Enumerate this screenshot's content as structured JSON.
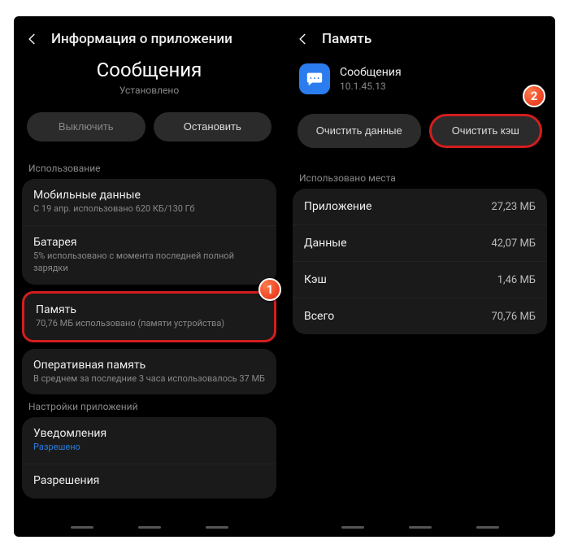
{
  "left": {
    "header_title": "Информация о приложении",
    "app_name": "Сообщения",
    "app_status": "Установлено",
    "btn_disable": "Выключить",
    "btn_stop": "Остановить",
    "section_usage": "Использование",
    "items": {
      "mobile_data": {
        "title": "Мобильные данные",
        "sub": "С 19 апр. использовано 620 КБ/130 Гб"
      },
      "battery": {
        "title": "Батарея",
        "sub": "5% использовано с момента последней полной зарядки"
      },
      "storage": {
        "title": "Память",
        "sub": "70,76 МБ использовано (памяти устройства)"
      },
      "ram": {
        "title": "Оперативная память",
        "sub": "В среднем за последние 3 часа использовалось 37 МБ"
      }
    },
    "section_app_settings": "Настройки приложений",
    "notifications": {
      "title": "Уведомления",
      "sub": "Разрешено"
    },
    "permissions_title": "Разрешения",
    "badge": "1"
  },
  "right": {
    "header_title": "Память",
    "app_name": "Сообщения",
    "app_version": "10.1.45.13",
    "btn_clear_data": "Очистить данные",
    "btn_clear_cache": "Очистить кэш",
    "badge": "2",
    "section_used": "Использовано места",
    "rows": {
      "app": {
        "k": "Приложение",
        "v": "27,23 МБ"
      },
      "data": {
        "k": "Данные",
        "v": "42,07 МБ"
      },
      "cache": {
        "k": "Кэш",
        "v": "1,46 МБ"
      },
      "total": {
        "k": "Всего",
        "v": "70,76 МБ"
      }
    }
  }
}
